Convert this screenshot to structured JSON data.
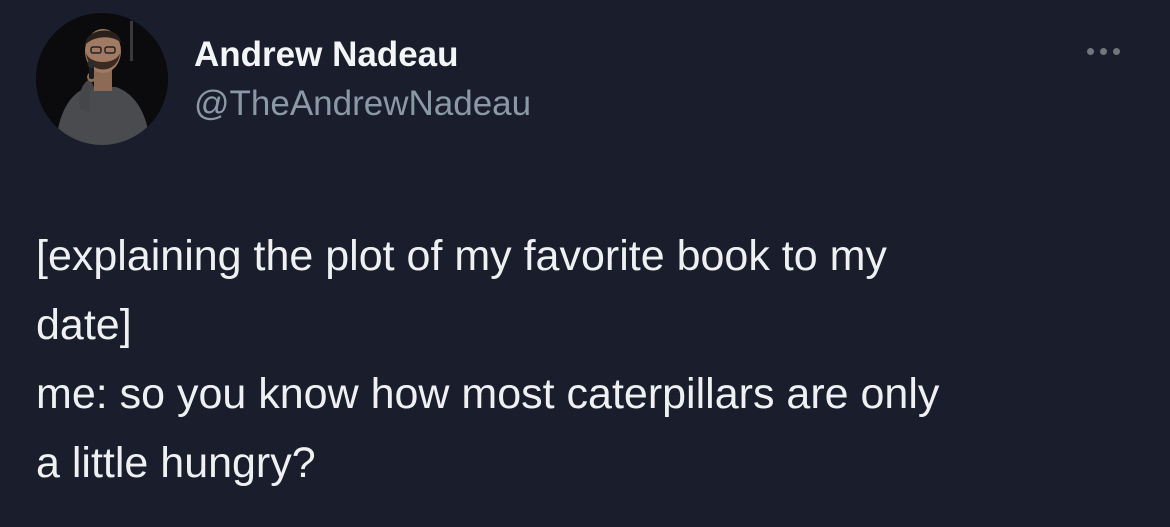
{
  "author": {
    "display_name": "Andrew Nadeau",
    "handle": "@TheAndrewNadeau",
    "avatar_icon": "profile-photo"
  },
  "menu": {
    "icon": "more-options-icon"
  },
  "tweet": {
    "lines": [
      "[explaining the plot of my favorite book to my",
      "date]",
      "me: so you know how most caterpillars are only",
      "a little hungry?"
    ]
  },
  "colors": {
    "background": "#1a1d2b",
    "text_primary": "#eef0f2",
    "text_secondary": "#8b98a5"
  }
}
